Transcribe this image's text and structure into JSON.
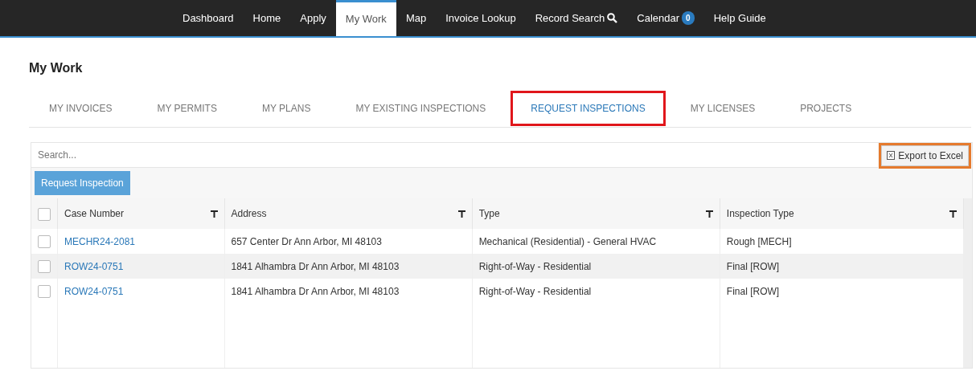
{
  "navbar": {
    "items": [
      {
        "label": "Dashboard",
        "selected": false
      },
      {
        "label": "Home",
        "selected": false
      },
      {
        "label": "Apply",
        "selected": false
      },
      {
        "label": "My Work",
        "selected": true
      },
      {
        "label": "Map",
        "selected": false
      },
      {
        "label": "Invoice Lookup",
        "selected": false
      },
      {
        "label": "Record Search",
        "selected": false,
        "kind": "search"
      },
      {
        "label": "Calendar",
        "selected": false,
        "kind": "badge",
        "badge": "0"
      },
      {
        "label": "Help Guide",
        "selected": false
      }
    ]
  },
  "page_title": "My Work",
  "tabs": [
    {
      "label": "MY INVOICES",
      "selected": false,
      "highlighted": false
    },
    {
      "label": "MY PERMITS",
      "selected": false,
      "highlighted": false
    },
    {
      "label": "MY PLANS",
      "selected": false,
      "highlighted": false
    },
    {
      "label": "MY EXISTING INSPECTIONS",
      "selected": false,
      "highlighted": false
    },
    {
      "label": "REQUEST INSPECTIONS",
      "selected": true,
      "highlighted": true
    },
    {
      "label": "MY LICENSES",
      "selected": false,
      "highlighted": false
    },
    {
      "label": "PROJECTS",
      "selected": false,
      "highlighted": false
    }
  ],
  "search": {
    "placeholder": "Search..."
  },
  "export_button": {
    "label": "Export to Excel",
    "highlighted": true
  },
  "request_button": {
    "label": "Request Inspection"
  },
  "table": {
    "select_all": {
      "checked": false
    },
    "columns": [
      "Case Number",
      "Address",
      "Type",
      "Inspection Type"
    ],
    "rows": [
      {
        "checked": false,
        "cells": [
          "MECHR24-2081",
          "657 Center Dr Ann Arbor, MI 48103",
          "Mechanical (Residential) - General HVAC",
          "Rough [MECH]"
        ]
      },
      {
        "checked": false,
        "cells": [
          "ROW24-0751",
          "1841 Alhambra Dr Ann Arbor, MI 48103",
          "Right-of-Way - Residential",
          "Final [ROW]"
        ]
      },
      {
        "checked": false,
        "cells": [
          "ROW24-0751",
          "1841 Alhambra Dr Ann Arbor, MI 48103",
          "Right-of-Way - Residential",
          "Final [ROW]"
        ]
      }
    ]
  }
}
